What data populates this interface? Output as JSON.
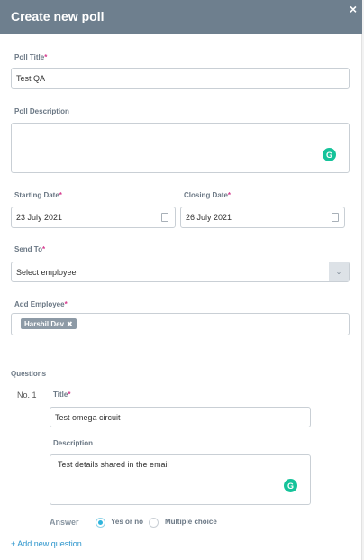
{
  "header": {
    "title": "Create new poll",
    "close": "×"
  },
  "form": {
    "poll_title": {
      "label": "Poll Title",
      "value": "Test QA"
    },
    "poll_description": {
      "label": "Poll Description",
      "value": ""
    },
    "starting_date": {
      "label": "Starting Date",
      "value": "23 July 2021"
    },
    "closing_date": {
      "label": "Closing Date",
      "value": "26 July 2021"
    },
    "send_to": {
      "label": "Send To",
      "value": "Select employee"
    },
    "add_employee": {
      "label": "Add Employee",
      "chips": [
        "Harshil Dev"
      ]
    },
    "required_marker": "*"
  },
  "questions": {
    "heading": "Questions",
    "items": [
      {
        "number": "No. 1",
        "title_label": "Title",
        "title_value": "Test omega circuit",
        "description_label": "Description",
        "description_value": "Test details shared in the email",
        "answer_label": "Answer",
        "options": [
          {
            "label": "Yes or no",
            "selected": true
          },
          {
            "label": "Multiple choice",
            "selected": false
          }
        ]
      }
    ],
    "add_link": "+ Add new question"
  },
  "colors": {
    "header": "#6e7f8e",
    "required": "#d63b8f",
    "link": "#2a94cc",
    "radio": "#2fb4dc",
    "grammarly": "#15c39a"
  },
  "icons": {
    "close": "close-icon",
    "calendar": "calendar-icon",
    "chevron": "chevron-down-icon",
    "grammarly": "grammarly-icon"
  }
}
